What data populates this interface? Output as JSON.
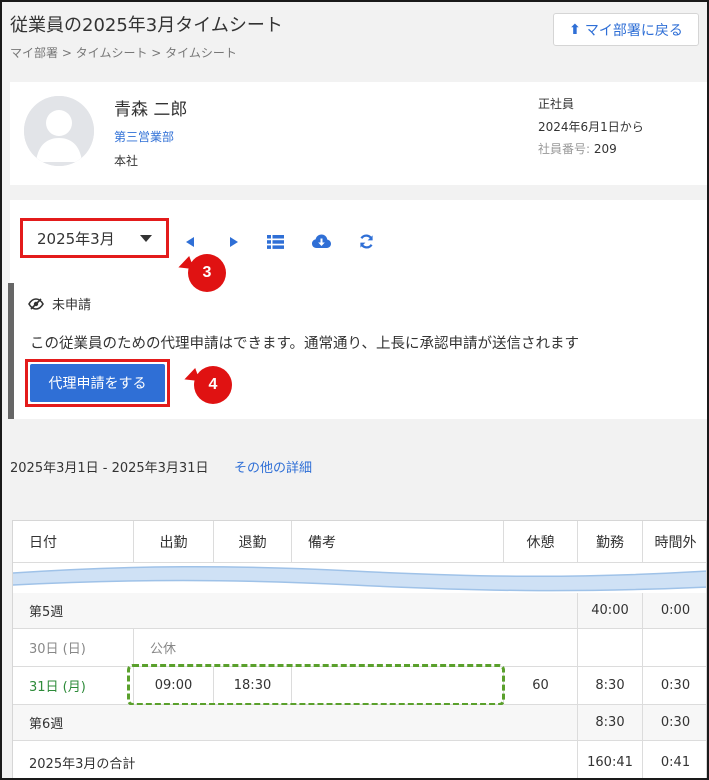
{
  "header": {
    "title": "従業員の2025年3月タイムシート",
    "breadcrumb": "マイ部署 > タイムシート > タイムシート",
    "back_button": "マイ部署に戻る"
  },
  "employee": {
    "name": "青森 二郎",
    "department": "第三営業部",
    "office": "本社",
    "employment_type": "正社員",
    "since": "2024年6月1日から",
    "number_label": "社員番号:",
    "number": "209"
  },
  "controls": {
    "month": "2025年3月",
    "status": "未申請",
    "notice": "この従業員のための代理申請はできます。通常通り、上長に承認申請が送信されます",
    "proxy_button": "代理申請をする",
    "badge_3": "3",
    "badge_4": "4"
  },
  "icons": [
    "triangle-left-icon",
    "triangle-right-icon",
    "list-icon",
    "cloud-download-icon",
    "refresh-icon",
    "eye-slash-icon",
    "person-silhouette-icon",
    "arrow-up-icon"
  ],
  "period": {
    "range": "2025年3月1日 - 2025年3月31日",
    "more_link": "その他の詳細"
  },
  "table": {
    "headers": [
      "日付",
      "出勤",
      "退勤",
      "備考",
      "休憩",
      "勤務",
      "時間外"
    ],
    "week5": {
      "label": "第5週",
      "work": "40:00",
      "overtime": "0:00"
    },
    "day30": {
      "date": "30日 (日)",
      "note": "公休"
    },
    "day31": {
      "date": "31日 (月)",
      "in": "09:00",
      "out": "18:30",
      "break": "60",
      "work": "8:30",
      "overtime": "0:30"
    },
    "week6": {
      "label": "第6週",
      "work": "8:30",
      "overtime": "0:30"
    },
    "total": {
      "label": "2025年3月の合計",
      "work": "160:41",
      "overtime": "0:41"
    }
  },
  "colors": {
    "accent": "#2f6fd6",
    "highlight": "#e31b1b",
    "today": "#2e8b3a",
    "dashed": "#5aa02c"
  }
}
